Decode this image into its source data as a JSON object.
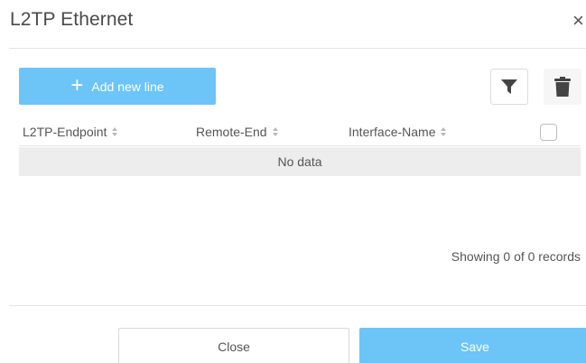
{
  "dialog": {
    "title": "L2TP Ethernet",
    "close_icon": "×"
  },
  "toolbar": {
    "add_label": "Add new line",
    "add_icon": "+",
    "filter_icon": "filter-icon",
    "delete_icon": "trash-icon"
  },
  "table": {
    "columns": [
      {
        "label": "L2TP-Endpoint"
      },
      {
        "label": "Remote-End"
      },
      {
        "label": "Interface-Name"
      }
    ],
    "empty_text": "No data",
    "records_text": "Showing 0 of 0 records"
  },
  "footer": {
    "close_label": "Close",
    "save_label": "Save"
  },
  "colors": {
    "accent": "#6cc4f7",
    "empty_row": "#ededed"
  }
}
